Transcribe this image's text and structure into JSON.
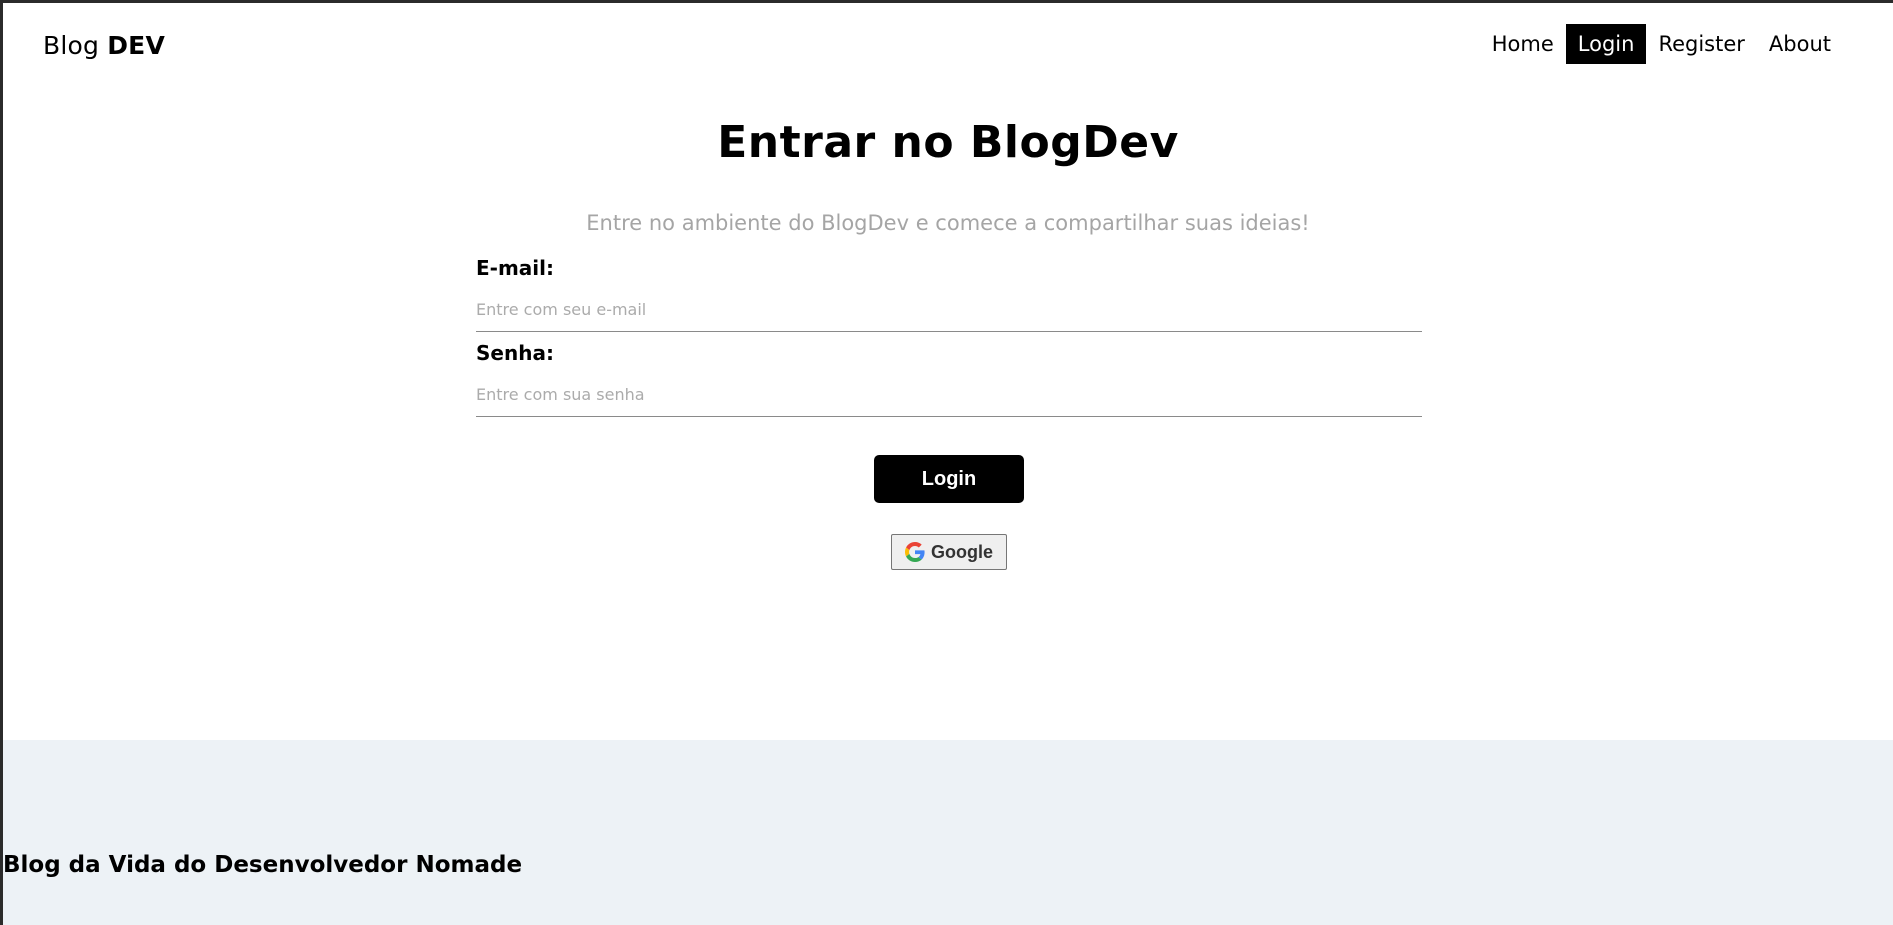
{
  "navbar": {
    "brand_prefix": "Blog",
    "brand_strong": "DEV",
    "links": [
      {
        "label": "Home"
      },
      {
        "label": "Login"
      },
      {
        "label": "Register"
      },
      {
        "label": "About"
      }
    ],
    "active": "Login"
  },
  "main": {
    "title": "Entrar no BlogDev",
    "subtitle": "Entre no ambiente do BlogDev e comece a compartilhar suas ideias!",
    "email": {
      "label": "E-mail:",
      "placeholder": "Entre com seu e-mail",
      "value": ""
    },
    "password": {
      "label": "Senha:",
      "placeholder": "Entre com sua senha",
      "value": ""
    },
    "login_button": "Login",
    "google_button": "Google"
  },
  "footer": {
    "text": "Blog da Vida do Desenvolvedor Nomade"
  },
  "colors": {
    "accent": "#000000",
    "footer_bg": "#edf2f6",
    "muted_text": "#a5a5a5"
  }
}
